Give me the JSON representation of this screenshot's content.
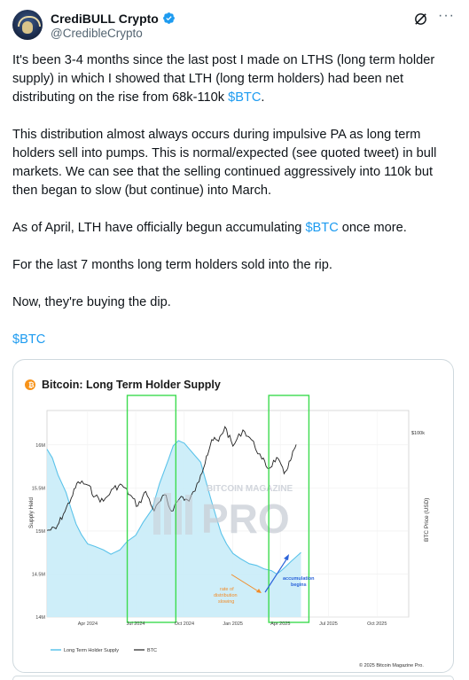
{
  "post": {
    "author_name": "CrediBULL Crypto",
    "author_handle": "@CredibleCrypto",
    "paragraphs": [
      [
        {
          "text": "It's been 3-4 months since the last post I made on LTHS (long term holder supply) in which I showed that LTH (long term holders) had been net distributing on the rise from 68k-110k "
        },
        {
          "text": "$BTC",
          "link": true
        },
        {
          "text": "."
        }
      ],
      [
        {
          "text": "This distribution almost always occurs during impulsive PA as long term holders sell into pumps. This is normal/expected (see quoted tweet) in bull markets. We can see that the selling continued aggressively into 110k but then began to slow (but continue) into March."
        }
      ],
      [
        {
          "text": "As of April, LTH have officially begun accumulating "
        },
        {
          "text": "$BTC",
          "link": true
        },
        {
          "text": " once more."
        }
      ],
      [
        {
          "text": "For the last 7 months long term holders sold into the rip."
        }
      ],
      [
        {
          "text": "Now, they're buying the dip."
        }
      ],
      [
        {
          "text": "$BTC",
          "link": true
        }
      ]
    ],
    "colors": {
      "link": "#1d9bf0",
      "verified": "#1d9bf0",
      "text": "#0f1419",
      "secondary": "#536471"
    },
    "icons": {
      "verified": "verified-badge-icon",
      "grok": "grok-icon",
      "more": "more-icon",
      "avatar": "bull-avatar"
    }
  },
  "chart": {
    "title": "Bitcoin: Long Term Holder Supply",
    "left_axis_label": "Supply Held",
    "right_axis_label": "BTC Price (USD)",
    "right_axis_tick": "$100k",
    "watermark_top": "BITCOIN MAGAZINE",
    "watermark_main": "PRO",
    "annotation_slowing": "rate of\ndistribution\nslowing",
    "annotation_accumulation": "accumulation\nbegins",
    "legend": [
      "Long Term Holder Supply",
      "BTC"
    ],
    "copyright": "© 2025 Bitcoin Magazine Pro.",
    "colors": {
      "supply_fill": "#c9ecf8",
      "supply_line": "#5bc3ea",
      "btc": "#222222",
      "highlight_box": "#3ddc4f",
      "orange_arrow": "#f28c28",
      "blue_arrow": "#2b63d9",
      "title_icon": "#f7931a"
    }
  },
  "chart_data": {
    "type": "area",
    "title": "Bitcoin: Long Term Holder Supply",
    "x_tick_labels": [
      "Apr 2024",
      "Jul 2024",
      "Oct 2024",
      "Jan 2025",
      "Apr 2025",
      "Jul 2025",
      "Oct 2025"
    ],
    "y_tick_labels": [
      "14M",
      "14.5M",
      "15M",
      "15.5M",
      "16M"
    ],
    "ylabel": "Supply Held",
    "y2label": "BTC Price (USD)",
    "ylim": [
      14000000,
      16400000
    ],
    "xlim": [
      "2024-01-15",
      "2025-11-30"
    ],
    "y2_tick_labels": [
      "$100k"
    ],
    "series": [
      {
        "name": "Long Term Holder Supply",
        "axis": "left",
        "x": [
          "2024-01-15",
          "2024-01-25",
          "2024-02-05",
          "2024-02-20",
          "2024-03-01",
          "2024-03-10",
          "2024-03-20",
          "2024-04-01",
          "2024-04-15",
          "2024-05-01",
          "2024-05-15",
          "2024-06-01",
          "2024-06-15",
          "2024-07-01",
          "2024-07-15",
          "2024-08-01",
          "2024-08-15",
          "2024-09-01",
          "2024-09-10",
          "2024-09-20",
          "2024-10-01",
          "2024-10-15",
          "2024-11-01",
          "2024-11-10",
          "2024-11-20",
          "2024-12-01",
          "2024-12-10",
          "2024-12-20",
          "2025-01-01",
          "2025-01-15",
          "2025-02-01",
          "2025-02-15",
          "2025-03-01",
          "2025-03-15",
          "2025-03-25",
          "2025-04-01",
          "2025-04-10",
          "2025-04-20",
          "2025-05-01",
          "2025-05-10"
        ],
        "values": [
          15950000,
          15850000,
          15650000,
          15450000,
          15250000,
          15080000,
          14960000,
          14850000,
          14820000,
          14780000,
          14730000,
          14780000,
          14880000,
          14950000,
          15100000,
          15250000,
          15550000,
          15830000,
          15990000,
          16050000,
          16020000,
          15920000,
          15800000,
          15600000,
          15380000,
          15150000,
          14970000,
          14850000,
          14740000,
          14680000,
          14620000,
          14600000,
          14560000,
          14540000,
          14500000,
          14530000,
          14580000,
          14640000,
          14700000,
          14750000
        ]
      },
      {
        "name": "BTC",
        "axis": "right",
        "x": [
          "2024-01-15",
          "2024-02-01",
          "2024-02-15",
          "2024-03-01",
          "2024-03-14",
          "2024-04-01",
          "2024-04-15",
          "2024-05-01",
          "2024-05-20",
          "2024-06-05",
          "2024-06-20",
          "2024-07-05",
          "2024-07-20",
          "2024-08-05",
          "2024-08-25",
          "2024-09-06",
          "2024-09-25",
          "2024-10-10",
          "2024-10-29",
          "2024-11-12",
          "2024-11-22",
          "2024-12-05",
          "2024-12-17",
          "2025-01-01",
          "2025-01-20",
          "2025-02-05",
          "2025-02-25",
          "2025-03-10",
          "2025-03-25",
          "2025-04-08",
          "2025-04-20",
          "2025-05-01"
        ],
        "values": [
          42000,
          43000,
          52000,
          62000,
          72000,
          70000,
          63000,
          60000,
          68000,
          70000,
          64000,
          57000,
          66000,
          54000,
          64000,
          54000,
          63000,
          60000,
          72000,
          88000,
          98000,
          97000,
          106000,
          94000,
          104000,
          98000,
          86000,
          80000,
          87000,
          77000,
          85000,
          95000
        ]
      }
    ],
    "highlight_ranges": [
      [
        "2024-06-15",
        "2024-09-15"
      ],
      [
        "2025-03-10",
        "2025-05-25"
      ]
    ]
  }
}
